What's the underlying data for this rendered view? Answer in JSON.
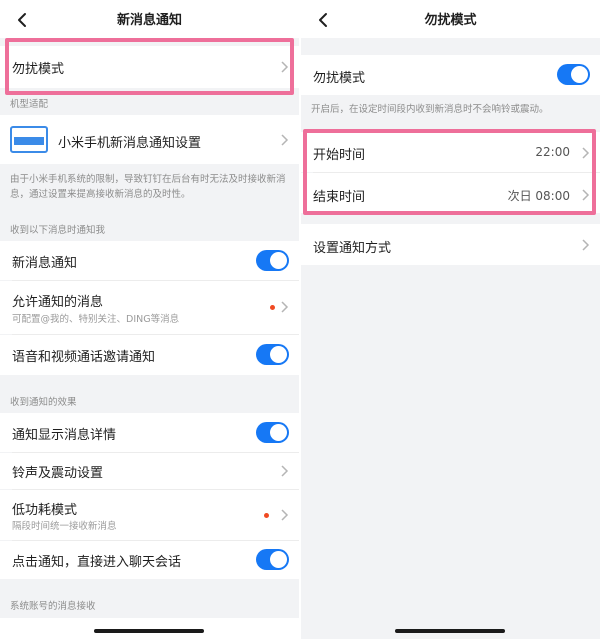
{
  "left": {
    "title": "新消息通知",
    "dnd_row": {
      "label": "勿扰模式"
    },
    "device_section": {
      "label": "机型适配"
    },
    "device_row": {
      "label": "小米手机新消息通知设置"
    },
    "device_note": "由于小米手机系统的限制，导致钉钉在后台有时无法及时接收新消息，通过设置来提高接收新消息的及时性。",
    "receive_section": {
      "label": "收到以下消息时通知我"
    },
    "new_msg": {
      "label": "新消息通知",
      "enabled": true
    },
    "allowed": {
      "label": "允许通知的消息",
      "sub": "可配置@我的、特别关注、DING等消息"
    },
    "call_invite": {
      "label": "语音和视频通话邀请通知",
      "enabled": true
    },
    "effect_section": {
      "label": "收到通知的效果"
    },
    "show_detail": {
      "label": "通知显示消息详情",
      "enabled": true
    },
    "ringtone": {
      "label": "铃声及震动设置"
    },
    "low_power": {
      "label": "低功耗模式",
      "sub": "隔段时间统一接收新消息"
    },
    "tap_open": {
      "label": "点击通知，直接进入聊天会话",
      "enabled": true
    },
    "system_section": {
      "label": "系统账号的消息接收"
    }
  },
  "right": {
    "title": "勿扰模式",
    "dnd_toggle": {
      "label": "勿扰模式",
      "enabled": true
    },
    "dnd_note": "开启后，在设定时间段内收到新消息时不会响铃或震动。",
    "start": {
      "label": "开始时间",
      "value": "22:00"
    },
    "end": {
      "label": "结束时间",
      "value": "次日 08:00"
    },
    "method": {
      "label": "设置通知方式"
    }
  },
  "colors": {
    "accent": "#1678f5",
    "highlight": "#ee6f9a",
    "badge": "#f04a22"
  }
}
